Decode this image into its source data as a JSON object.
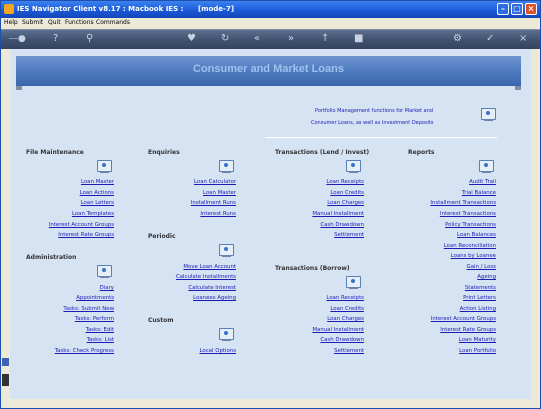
{
  "window": {
    "title": "IES Navigator Client v8.17 : Macbook IES :      [mode-7]"
  },
  "menu": [
    "Help",
    "Submit",
    "Quit",
    "Functions",
    "Commands"
  ],
  "banner_title": "Consumer and Market Loans",
  "portfolio_note": {
    "line1": "Portfolio Management functions for Market and",
    "line2": "Consumer Loans, as well as Investment Deposits"
  },
  "sections": {
    "file_maintenance": {
      "title": "File Maintenance",
      "items": [
        "Loan Master",
        "Loan Actions",
        "Loan Letters",
        "Loan Templates",
        "Interest Account Groups",
        "Interest Rate Groups"
      ]
    },
    "administration": {
      "title": "Administration",
      "items": [
        "Diary",
        "Appointments",
        "Tasks: Submit New",
        "Tasks: Perform",
        "Tasks: Edit",
        "Tasks: List",
        "Tasks: Check Progress"
      ]
    },
    "enquiries": {
      "title": "Enquiries",
      "items": [
        "Loan Calculator",
        "Loan Master",
        "Installment Runs",
        "Interest Runs"
      ]
    },
    "periodic": {
      "title": "Periodic",
      "items": [
        "Move Loan Account",
        "Calculate Installments",
        "Calculate Interest",
        "Loanees Ageing"
      ]
    },
    "custom": {
      "title": "Custom",
      "items": [
        "Local Options"
      ]
    },
    "transactions_lend": {
      "title": "Transactions (Lend / Invest)",
      "items": [
        "Loan Receipts",
        "Loan Credits",
        "Loan Charges",
        "Manual Installment",
        "Cash Drawdown",
        "Settlement"
      ]
    },
    "transactions_borrow": {
      "title": "Transactions (Borrow)",
      "items": [
        "Loan Receipts",
        "Loan Credits",
        "Loan Charges",
        "Manual Installment",
        "Cash Drawdown",
        "Settlement"
      ]
    },
    "reports": {
      "title": "Reports",
      "items": [
        "Audit Trail",
        "Trial Balance",
        "Installment Transactions",
        "Interest Transactions",
        "Policy Transactions",
        "Loan Balances",
        "Loan Reconciliation",
        "Loans by Loanee",
        "Gain / Loss",
        "Ageing",
        "Statements",
        "Print Letters",
        "Action Listing",
        "Interest Account Groups",
        "Interest Rate Groups",
        "Loan Maturity",
        "Loan Portfolio"
      ]
    }
  }
}
